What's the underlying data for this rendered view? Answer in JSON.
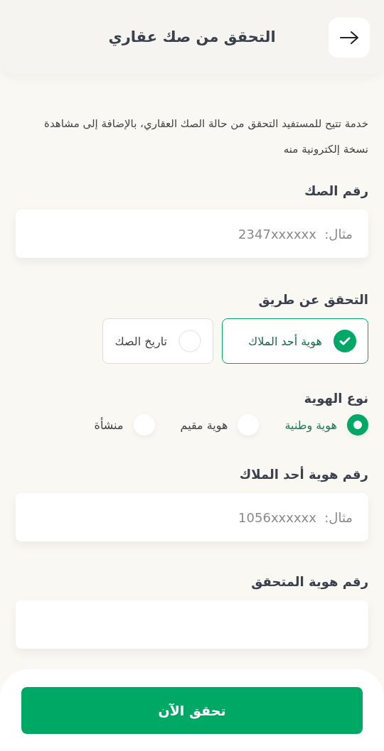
{
  "header": {
    "title": "التحقق من صك عقاري"
  },
  "description": "خدمة تتيح للمستفيد التحقق من حالة الصك العقاري، بالإضافة إلى مشاهدة نسخة إلكترونية منه",
  "deed_number": {
    "label": "رقم الصك",
    "placeholder": "مثال:  2347xxxxxx"
  },
  "verify_by": {
    "label": "التحقق عن طريق",
    "options": [
      {
        "label": "هوية أحد الملاك",
        "selected": true
      },
      {
        "label": "تاريخ الصك",
        "selected": false
      }
    ]
  },
  "id_type": {
    "label": "نوع الهوية",
    "options": [
      {
        "label": "هوية وطنية",
        "selected": true
      },
      {
        "label": "هوية مقيم",
        "selected": false
      },
      {
        "label": "منشأة",
        "selected": false
      }
    ]
  },
  "owner_id": {
    "label": "رقم هوية أحد الملاك",
    "placeholder": "مثال:  1056xxxxxx"
  },
  "verifier_id": {
    "label": "رقم هوية المتحقق"
  },
  "submit_button": "تحقق الآن"
}
